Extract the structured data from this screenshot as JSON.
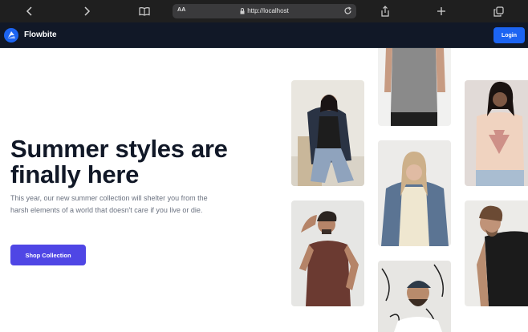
{
  "browser": {
    "url": "http://localhost",
    "text_size_label": "AA",
    "icons": [
      "back-icon",
      "forward-icon",
      "reader-icon",
      "lock-icon",
      "reload-icon",
      "share-icon",
      "new-tab-icon",
      "tabs-icon"
    ]
  },
  "navbar": {
    "brand": "Flowbite",
    "login_label": "Login"
  },
  "hero": {
    "title": "Summer styles are finally here",
    "description": "This year, our new summer collection will shelter you from the harsh elements of a world that doesn't care if you live or die.",
    "cta_label": "Shop Collection"
  },
  "colors": {
    "navbar_bg": "#111827",
    "brand_blue": "#1c64f2",
    "cta_indigo": "#4f46e5",
    "heading": "#111827",
    "body_text": "#6b7280"
  }
}
